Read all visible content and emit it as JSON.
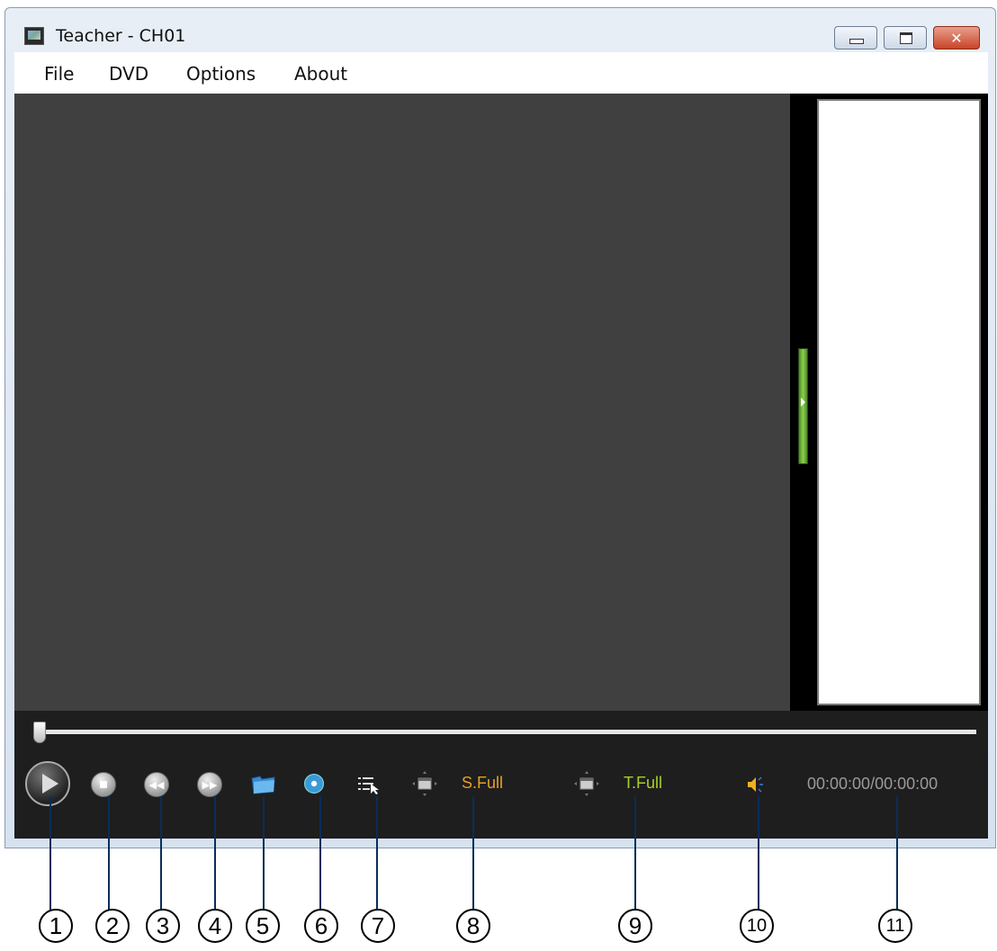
{
  "window": {
    "title": "Teacher - CH01",
    "close_glyph": "✕"
  },
  "menu": {
    "items": [
      "File",
      "DVD",
      "Options",
      "About"
    ]
  },
  "player": {
    "seek_position": 0,
    "screen_size_label": "S.Full",
    "teacher_size_label": "T.Full",
    "time_display": "00:00:00/00:00:00",
    "labels_color_s": "#e8a020",
    "labels_color_t": "#a8d028"
  },
  "icons": [
    "play-icon",
    "stop-icon",
    "previous-icon",
    "next-icon",
    "folder-icon",
    "dvd-icon",
    "playlist-icon",
    "screen-size-icon",
    "teacher-size-icon",
    "speaker-icon"
  ],
  "callouts": [
    "1",
    "2",
    "3",
    "4",
    "5",
    "6",
    "7",
    "8",
    "9",
    "10",
    "11"
  ]
}
